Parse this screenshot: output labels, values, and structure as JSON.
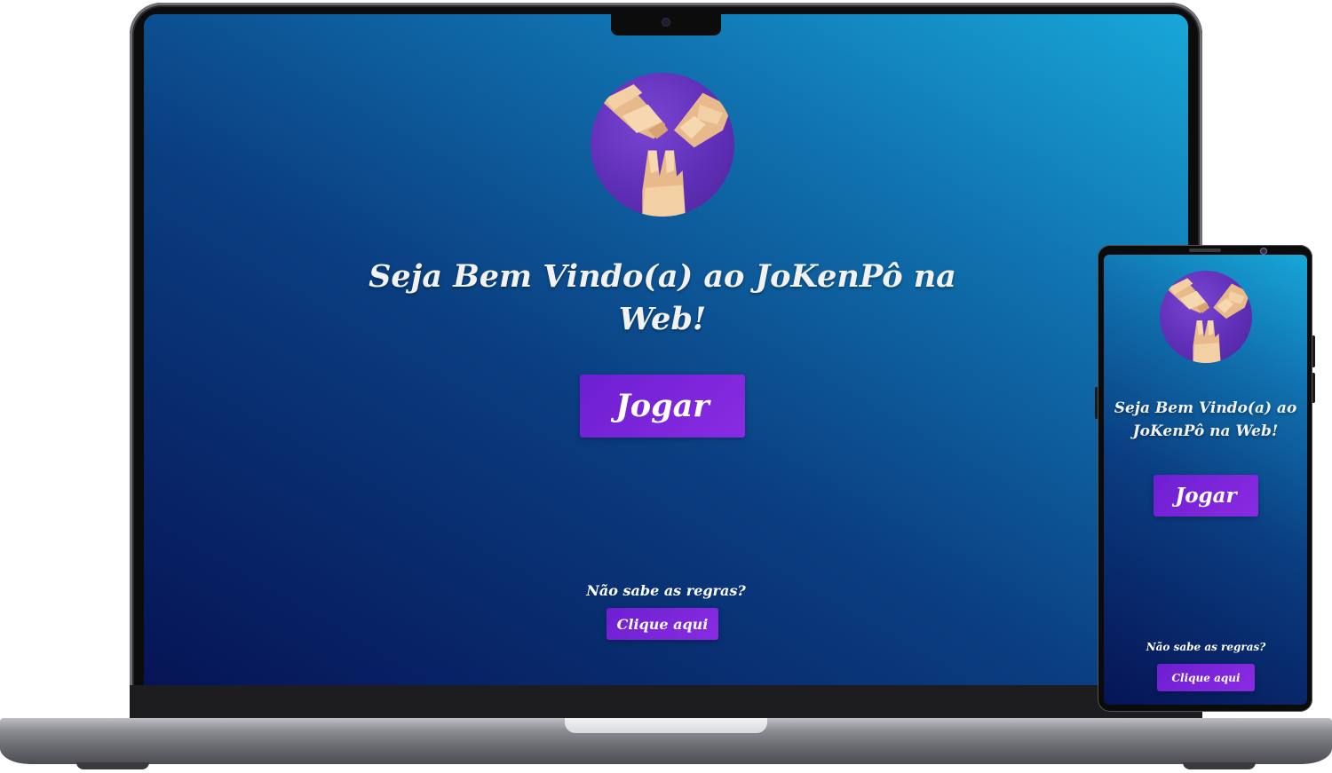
{
  "app": {
    "title": "Seja Bem Vindo(a) ao JoKenPô na Web!",
    "play_button": "Jogar",
    "rules_question": "Não sabe as regras?",
    "rules_button": "Clique aqui"
  },
  "colors": {
    "background_gradient_start": "#061455",
    "background_gradient_end": "#18a7d8",
    "button": "#7a26d9",
    "logo_circle": "#6a35c4",
    "text": "#f2f2f2"
  },
  "icons": {
    "logo": "rock-paper-scissors-hands-icon"
  }
}
